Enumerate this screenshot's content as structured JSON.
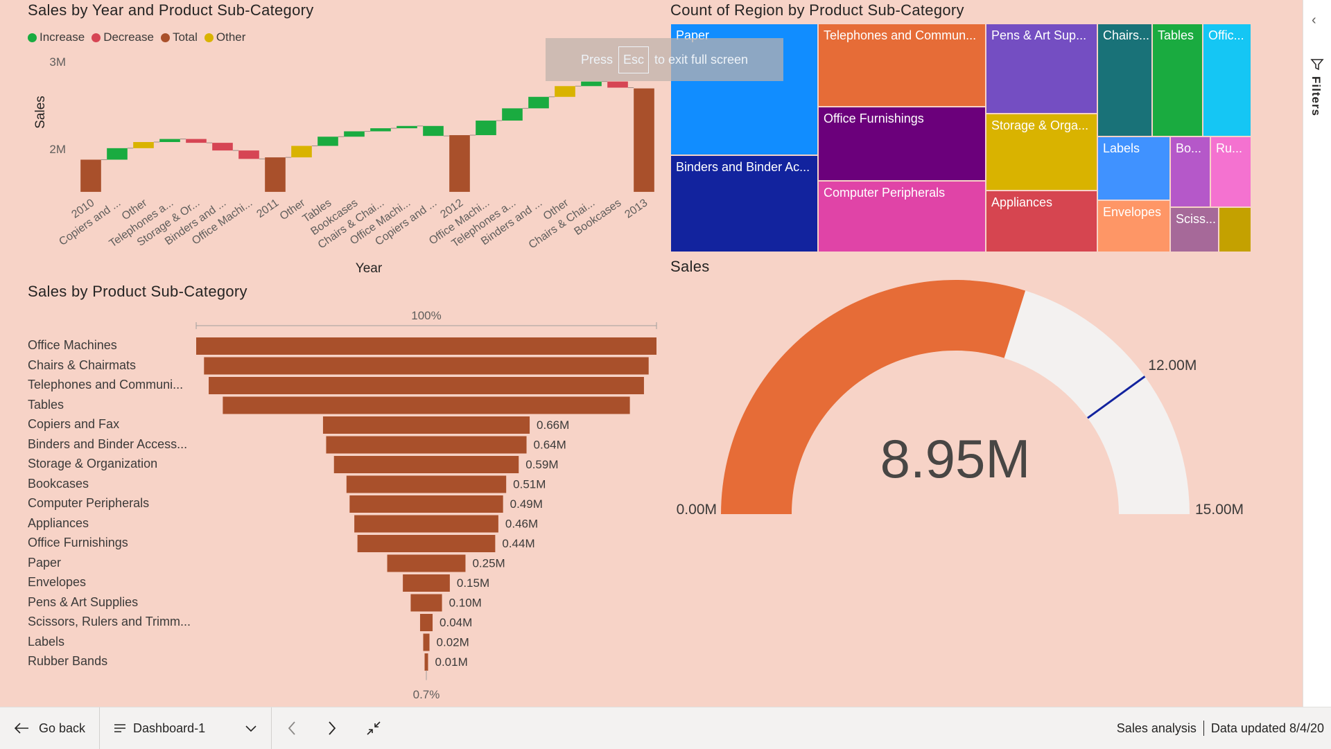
{
  "waterfall": {
    "title": "Sales by Year and Product Sub-Category",
    "legend": [
      {
        "label": "Increase",
        "color": "#1aab40"
      },
      {
        "label": "Decrease",
        "color": "#d64554"
      },
      {
        "label": "Total",
        "color": "#a9502b"
      },
      {
        "label": "Other",
        "color": "#d9b300"
      }
    ],
    "xlabel": "Year",
    "ylabel": "Sales",
    "yticks": [
      "3M",
      "2M"
    ]
  },
  "chart_data": [
    {
      "type": "bar",
      "title": "Sales by Year and Product Sub-Category",
      "xlabel": "Year",
      "ylabel": "Sales",
      "ylim": [
        1.55,
        3.25
      ],
      "categories": [
        "2010",
        "Copiers and ...",
        "Other",
        "Telephones a...",
        "Storage & Or...",
        "Binders and ...",
        "Office Machi...",
        "2011",
        "Other",
        "Tables",
        "Bookcases",
        "Chairs & Chai...",
        "Office Machi...",
        "Copiers and ...",
        "2012",
        "Office Machi...",
        "Telephones a...",
        "Binders and ...",
        "Other",
        "Chairs & Chai...",
        "Bookcases",
        "2013"
      ],
      "kinds": [
        "total",
        "increase",
        "other",
        "increase",
        "decrease",
        "decrease",
        "decrease",
        "total",
        "other",
        "increase",
        "increase",
        "increase",
        "increase",
        "increase",
        "total",
        "increase",
        "increase",
        "increase",
        "other",
        "increase",
        "decrease",
        "total"
      ],
      "ranges": [
        [
          1.56,
          1.98
        ],
        [
          1.98,
          2.13
        ],
        [
          2.13,
          2.21
        ],
        [
          2.21,
          2.25
        ],
        [
          2.25,
          2.2
        ],
        [
          2.2,
          2.1
        ],
        [
          2.1,
          1.99
        ],
        [
          1.56,
          2.01
        ],
        [
          2.01,
          2.16
        ],
        [
          2.16,
          2.28
        ],
        [
          2.28,
          2.35
        ],
        [
          2.35,
          2.39
        ],
        [
          2.39,
          2.42
        ],
        [
          2.42,
          2.29
        ],
        [
          1.56,
          2.3
        ],
        [
          2.3,
          2.49
        ],
        [
          2.49,
          2.65
        ],
        [
          2.65,
          2.8
        ],
        [
          2.8,
          2.94
        ],
        [
          2.94,
          3.0
        ],
        [
          3.0,
          2.92
        ],
        [
          1.56,
          2.91
        ]
      ]
    },
    {
      "type": "bar",
      "title": "Sales by Product Sub-Category",
      "top_label": "100%",
      "bottom_label": "0.7%",
      "categories": [
        "Office Machines",
        "Chairs & Chairmats",
        "Telephones and Communi...",
        "Tables",
        "Copiers and Fax",
        "Binders and Binder Access...",
        "Storage & Organization",
        "Bookcases",
        "Computer Peripherals",
        "Appliances",
        "Office Furnishings",
        "Paper",
        "Envelopes",
        "Pens & Art Supplies",
        "Scissors, Rulers and Trimm...",
        "Labels",
        "Rubber Bands"
      ],
      "values": [
        1.47,
        1.42,
        1.39,
        1.3,
        0.66,
        0.64,
        0.59,
        0.51,
        0.49,
        0.46,
        0.44,
        0.25,
        0.15,
        0.1,
        0.04,
        0.02,
        0.01
      ],
      "data_labels": [
        "",
        "",
        "",
        "",
        "0.66M",
        "0.64M",
        "0.59M",
        "0.51M",
        "0.49M",
        "0.46M",
        "0.44M",
        "0.25M",
        "0.15M",
        "0.10M",
        "0.04M",
        "0.02M",
        "0.01M"
      ]
    },
    {
      "type": "gauge",
      "title": "Sales",
      "value": 8.95,
      "value_label": "8.95M",
      "min": 0,
      "max": 15,
      "target": 12,
      "min_label": "0.00M",
      "max_label": "15.00M",
      "target_label": "12.00M"
    }
  ],
  "treemap": {
    "title": "Count of Region by Product Sub-Category",
    "cells": [
      {
        "label": "Paper",
        "color": "#118dff"
      },
      {
        "label": "Binders and Binder Ac...",
        "color": "#12239e"
      },
      {
        "label": "Telephones and Commun...",
        "color": "#e66c37"
      },
      {
        "label": "Office Furnishings",
        "color": "#6b007b"
      },
      {
        "label": "Computer Peripherals",
        "color": "#e044a7"
      },
      {
        "label": "Pens & Art Sup...",
        "color": "#744ec2"
      },
      {
        "label": "Storage & Orga...",
        "color": "#d9b300"
      },
      {
        "label": "Appliances",
        "color": "#d64550"
      },
      {
        "label": "Chairs...",
        "color": "#197278"
      },
      {
        "label": "Tables",
        "color": "#1aab40"
      },
      {
        "label": "Offic...",
        "color": "#15c6f4"
      },
      {
        "label": "Labels",
        "color": "#4092ff"
      },
      {
        "label": "Bo...",
        "color": "#b558c9"
      },
      {
        "label": "Ru...",
        "color": "#f472d0"
      },
      {
        "label": "Envelopes",
        "color": "#fe9666"
      },
      {
        "label": "Sciss...",
        "color": "#a66999"
      },
      {
        "label": "",
        "color": "#c4a100"
      }
    ]
  },
  "toast": {
    "press": "Press",
    "key": "Esc",
    "rest": "to exit full screen"
  },
  "sidebar": {
    "label": "Filters"
  },
  "footer": {
    "go_back": "Go back",
    "page_name": "Dashboard-1",
    "report_name": "Sales analysis",
    "updated": "Data updated 8/4/20"
  }
}
